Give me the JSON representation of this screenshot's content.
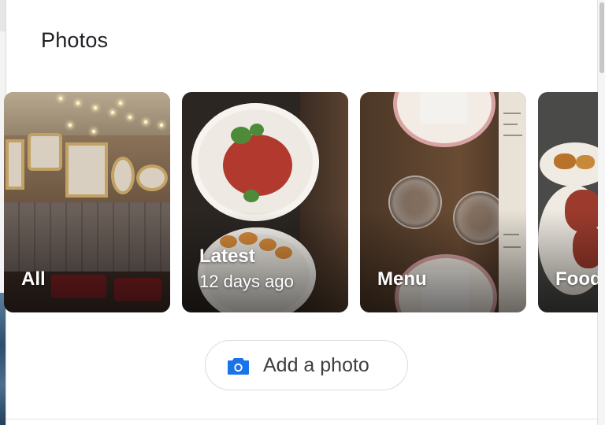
{
  "panel": {
    "title": "Photos"
  },
  "photo_categories": [
    {
      "label": "All",
      "sublabel": ""
    },
    {
      "label": "Latest",
      "sublabel": "12 days ago"
    },
    {
      "label": "Menu",
      "sublabel": ""
    },
    {
      "label": "Food",
      "sublabel": ""
    }
  ],
  "actions": {
    "add_photo_label": "Add a photo",
    "add_photo_icon": "camera-icon"
  },
  "colors": {
    "accent_blue": "#1a73e8",
    "title_text": "#202124",
    "button_text": "#3c4043",
    "button_border": "#dadce0"
  }
}
